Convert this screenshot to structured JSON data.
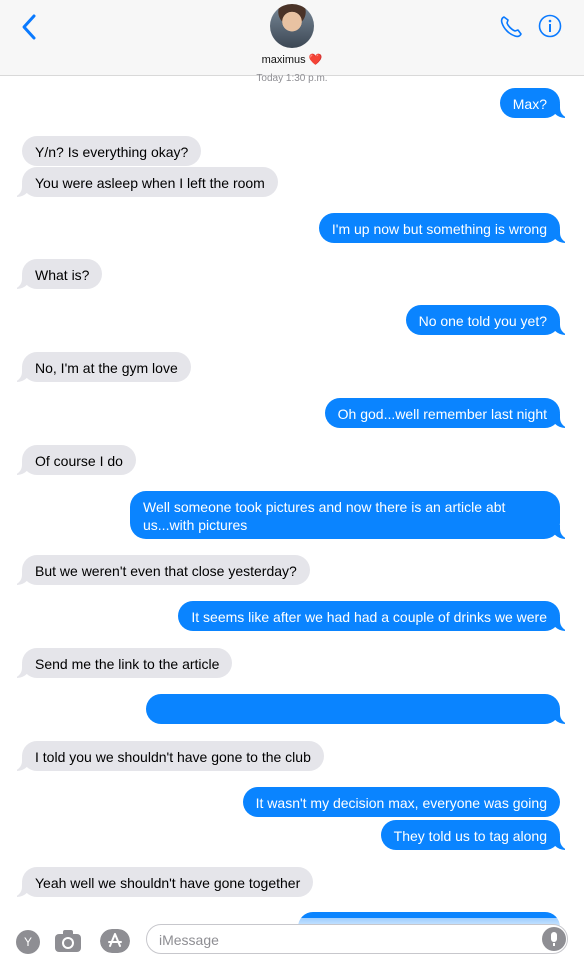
{
  "header": {
    "contact_name": "maximus",
    "heart": "❤️"
  },
  "timestamp": "Today 1:30 p.m.",
  "messages": [
    {
      "from": "me",
      "text": "Max?"
    },
    {
      "from": "them",
      "text": "Y/n? Is everything okay?"
    },
    {
      "from": "them",
      "text": "You were asleep when I left the room"
    },
    {
      "from": "me",
      "text": "I'm up now but something is wrong"
    },
    {
      "from": "them",
      "text": "What is?"
    },
    {
      "from": "me",
      "text": "No one told you yet?"
    },
    {
      "from": "them",
      "text": "No, I'm at the gym love"
    },
    {
      "from": "me",
      "text": "Oh god...well remember last night"
    },
    {
      "from": "them",
      "text": "Of course I do"
    },
    {
      "from": "me",
      "text": "Well someone took pictures and now there is an article abt us...with pictures"
    },
    {
      "from": "them",
      "text": "But we weren't even that close yesterday?"
    },
    {
      "from": "me",
      "text": "It seems like after we had had a couple of drinks we were"
    },
    {
      "from": "them",
      "text": "Send me the link to the article"
    },
    {
      "from": "me",
      "text": ""
    },
    {
      "from": "them",
      "text": "I told you we shouldn't have gone to the club"
    },
    {
      "from": "me",
      "text": "It wasn't my decision max, everyone was going"
    },
    {
      "from": "me",
      "text": "They told us to tag along"
    },
    {
      "from": "them",
      "text": "Yeah well we shouldn't have gone together"
    },
    {
      "from": "me",
      "text": ""
    }
  ],
  "composer": {
    "y_icon_letter": "Y",
    "placeholder": "iMessage"
  },
  "colors": {
    "outgoing": "#0a84ff",
    "incoming": "#e5e5ea",
    "accent": "#0a7aff"
  }
}
